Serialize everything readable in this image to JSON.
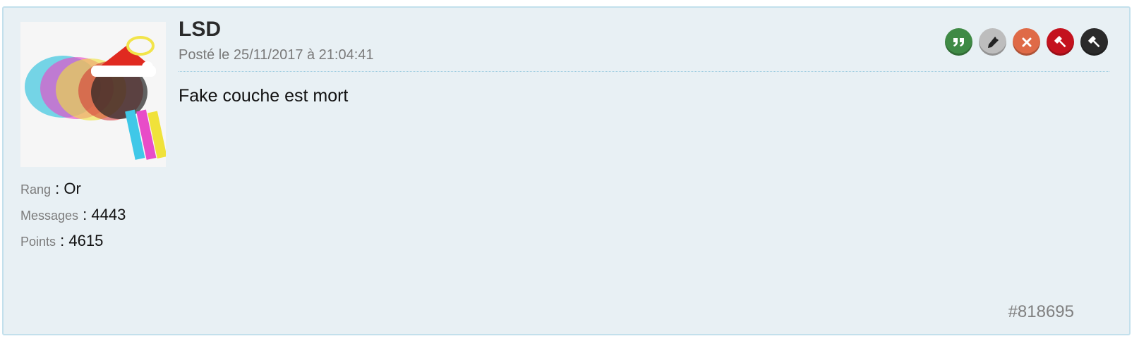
{
  "post": {
    "author": "LSD",
    "date": "Posté le 25/11/2017 à 21:04:41",
    "content": "Fake couche est mort",
    "id": "#818695",
    "avatar": "guinea-pig-santa-hat-avatar"
  },
  "stats": {
    "rank_label": "Rang",
    "rank_value": "Or",
    "messages_label": "Messages",
    "messages_value": "4443",
    "points_label": "Points",
    "points_value": "4615",
    "separator": " : "
  },
  "actions": [
    {
      "name": "quote",
      "icon": "quote-icon",
      "color": "#3f8a45"
    },
    {
      "name": "edit",
      "icon": "pencil-icon",
      "color": "#bdbdbd"
    },
    {
      "name": "delete",
      "icon": "close-icon",
      "color": "#df6a47"
    },
    {
      "name": "moderate",
      "icon": "gavel-icon",
      "color": "#c4121e"
    },
    {
      "name": "moderate-alt",
      "icon": "gavel-icon",
      "color": "#2a2a2a"
    }
  ],
  "colors": {
    "post_background": "#e8f0f4",
    "post_border": "#c3e0ec"
  }
}
